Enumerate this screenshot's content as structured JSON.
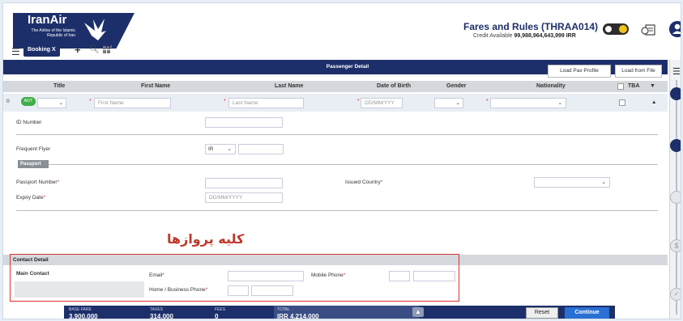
{
  "app": {
    "logo_name": "IranAir",
    "logo_subtitle": "The Airline of the Islamic Republic of Iran",
    "page_title": "Fares and Rules (THRAA014)",
    "credit_label": "Credit Available",
    "credit_value": "99,988,964,643,999 IRR"
  },
  "toolbar": {
    "tab_label": "Booking X",
    "add_label": "+",
    "grid_badge": "2"
  },
  "section": {
    "title": "Passenger Detail",
    "load_pax_profile": "Load Pax Profile",
    "load_from_file": "Load from File"
  },
  "columns": {
    "title": "Title",
    "first_name": "First Name",
    "last_name": "Last Name",
    "dob": "Date of Birth",
    "gender": "Gender",
    "nationality": "Nationality",
    "tba": "TBA"
  },
  "passenger": {
    "index": "0",
    "badge": "ADT",
    "first_name_placeholder": "First Name",
    "last_name_placeholder": "Last Name",
    "dob_placeholder": "DD/MM/YYY"
  },
  "fields": {
    "id_number": "ID Number",
    "frequent_flyer": "Frequent Flyer",
    "ff_code": "IR",
    "passport_header": "Passport",
    "passport_number": "Passport Number",
    "issued_country": "Issued Country",
    "expiry_date": "Expiry Date",
    "expiry_placeholder": "DD/MM/YYYY"
  },
  "annotation": {
    "persian_text": "کلیه پروازها"
  },
  "contact": {
    "header": "Contact Detail",
    "main_contact": "Main Contact",
    "email": "Email",
    "mobile_phone": "Mobile Phone",
    "home_phone": "Home / Business Phone"
  },
  "footer": {
    "base_fare_label": "BASE FARE",
    "base_fare_value": "3,900,000",
    "taxes_label": "TAXES",
    "taxes_value": "314,000",
    "fees_label": "FEES",
    "fees_value": "0",
    "total_label": "TOTAL",
    "total_value": "IRR 4,214,000",
    "reset": "Reset",
    "continue": "Continue"
  },
  "colors": {
    "brand": "#1d2f6a",
    "annotation": "#e03030",
    "primary_button": "#2a6fd3"
  }
}
